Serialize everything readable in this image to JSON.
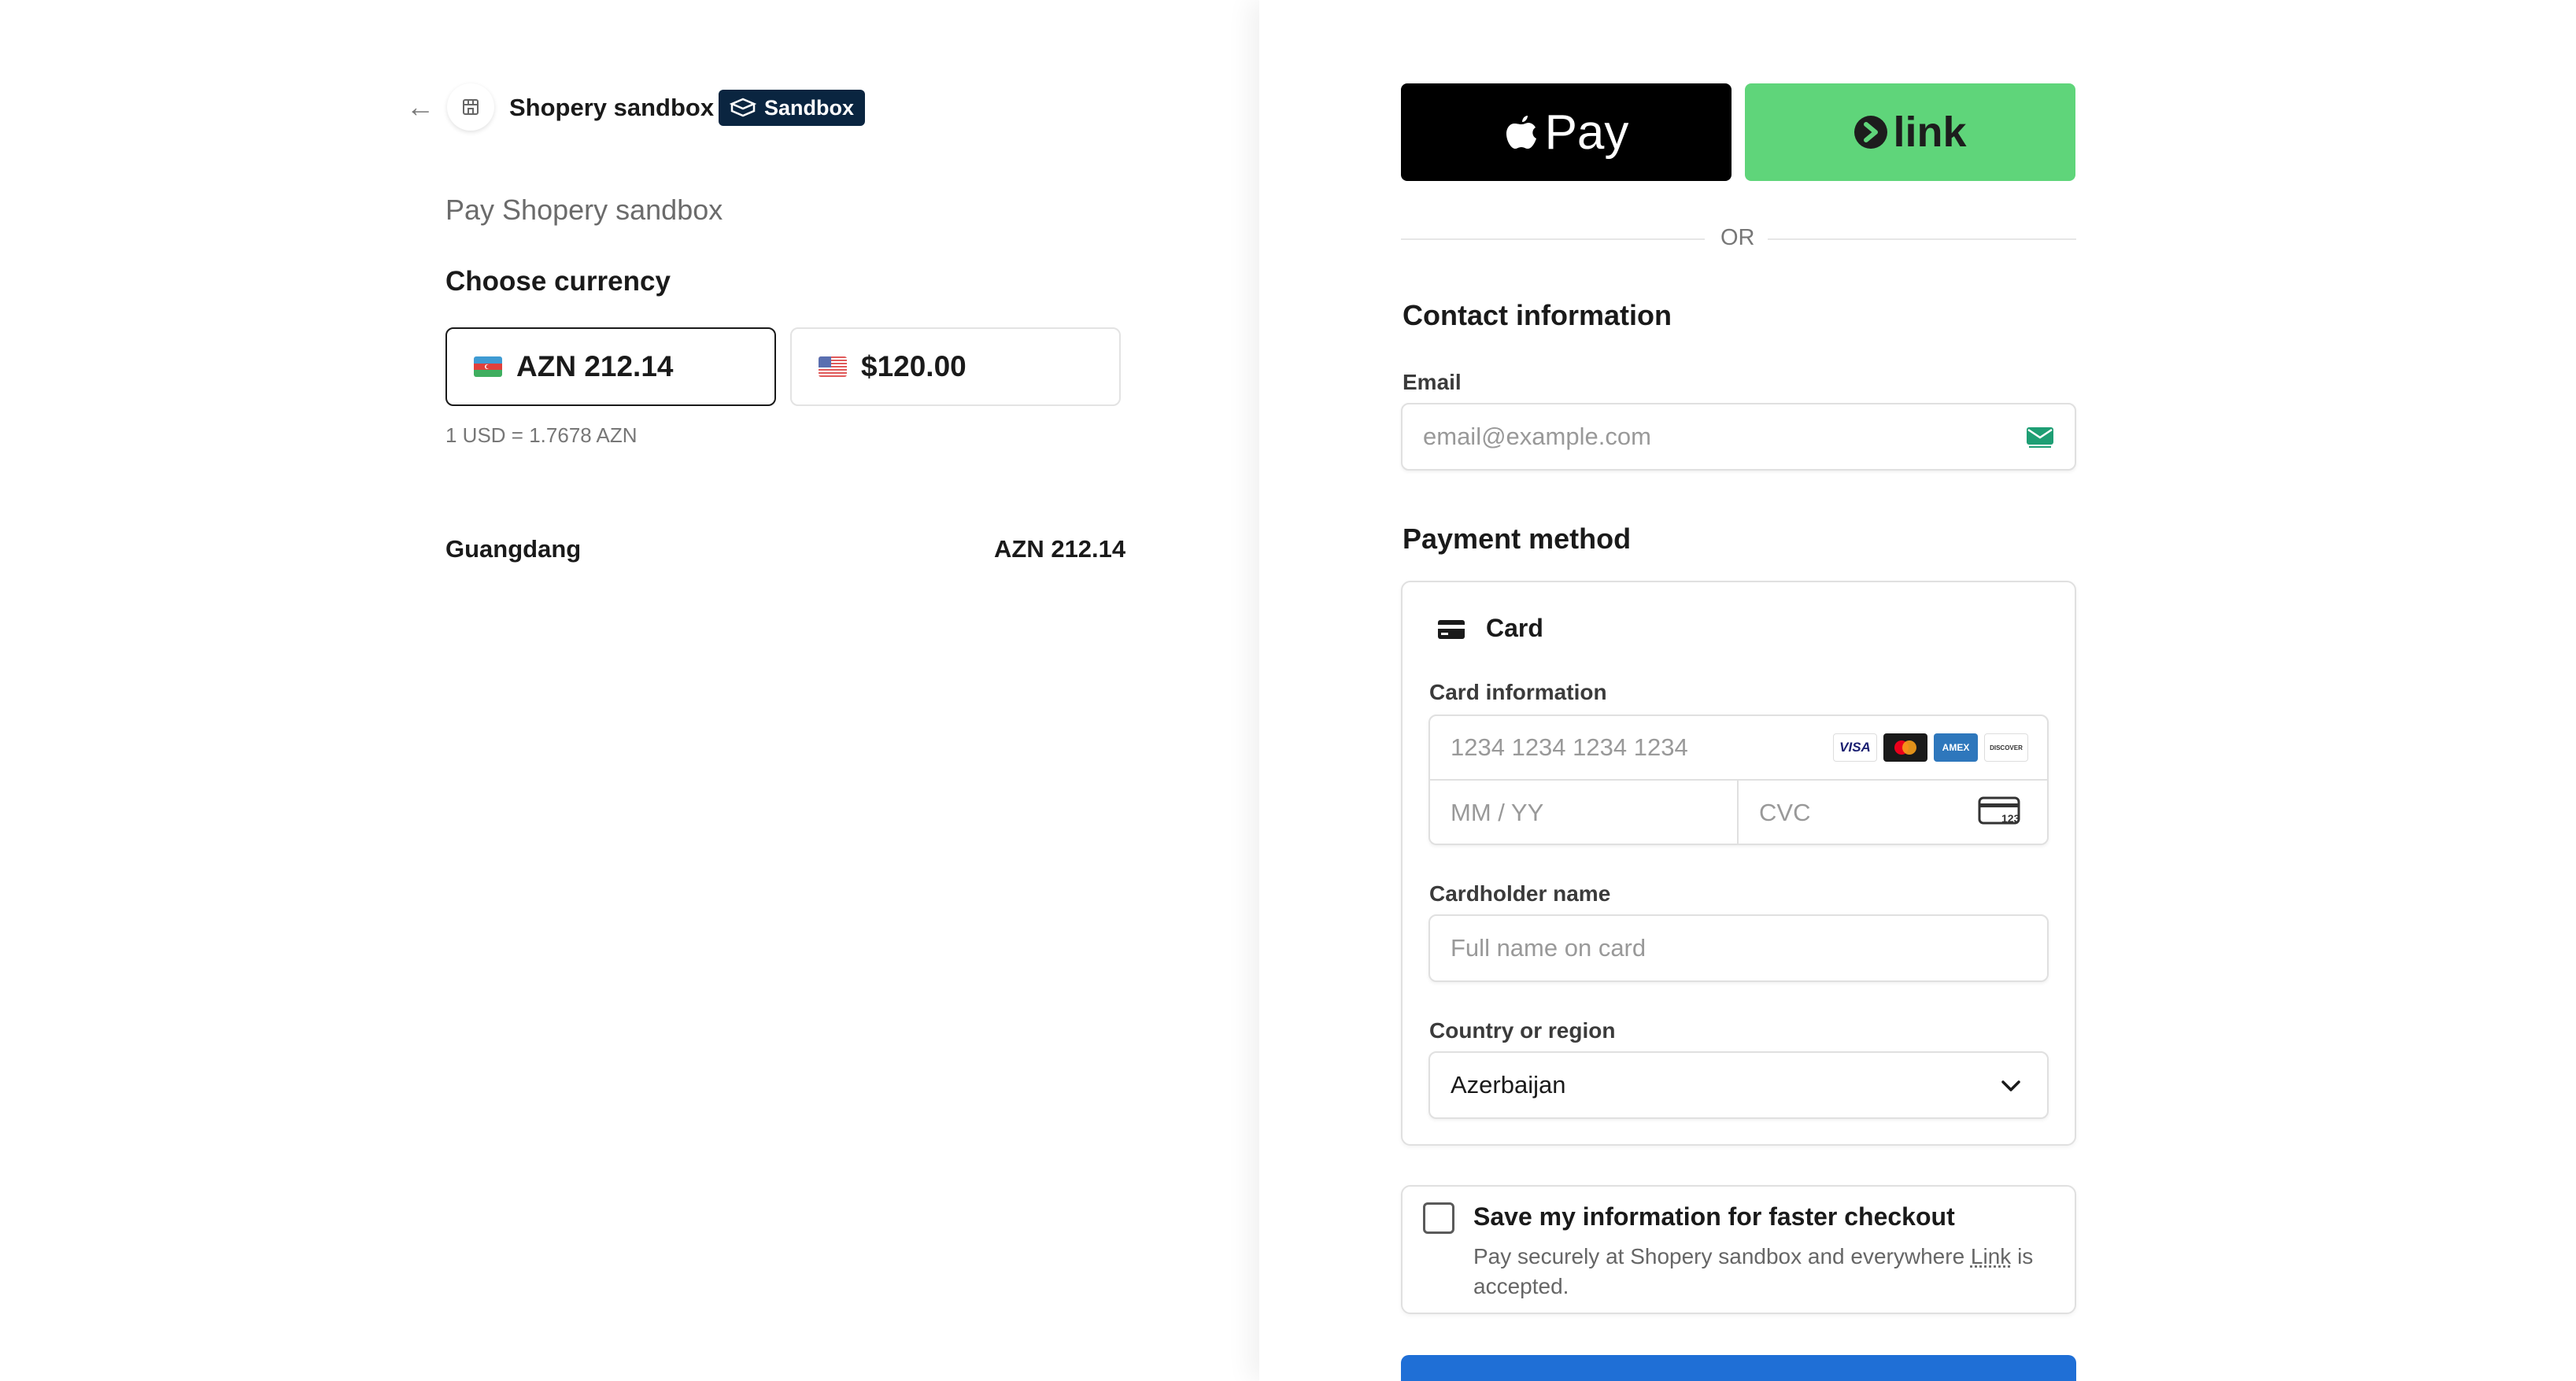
{
  "header": {
    "store_name": "Shopery sandbox",
    "badge": "Sandbox"
  },
  "summary": {
    "pay_title": "Pay Shopery sandbox",
    "choose_currency": "Choose currency",
    "currencies": [
      {
        "amount": "AZN 212.14",
        "flag": "az-flag-icon",
        "selected": true
      },
      {
        "amount": "$120.00",
        "flag": "us-flag-icon",
        "selected": false
      }
    ],
    "rate": "1 USD = 1.7678 AZN",
    "item": {
      "name": "Guangdang",
      "price": "AZN 212.14"
    }
  },
  "wallets": {
    "apple_pay_label": "Pay",
    "link_label": "link",
    "or_text": "OR"
  },
  "contact": {
    "title": "Contact information",
    "email_label": "Email",
    "email_placeholder": "email@example.com"
  },
  "payment": {
    "title": "Payment method",
    "method_label": "Card",
    "card_info_label": "Card information",
    "card_number_placeholder": "1234 1234 1234 1234",
    "expiry_placeholder": "MM / YY",
    "cvc_placeholder": "CVC",
    "cvc_icon_text": "123",
    "brands": [
      "VISA",
      "mastercard",
      "AMEX",
      "DISCOVER"
    ],
    "cardholder_label": "Cardholder name",
    "cardholder_placeholder": "Full name on card",
    "country_label": "Country or region",
    "country_value": "Azerbaijan"
  },
  "save": {
    "title": "Save my information for faster checkout",
    "desc_prefix": "Pay securely at Shopery sandbox and everywhere ",
    "desc_link": "Link",
    "desc_suffix": " is accepted."
  },
  "colors": {
    "badge_bg": "#0a2540",
    "link_green": "#5fd57a",
    "pay_button": "#1f6fd6"
  }
}
